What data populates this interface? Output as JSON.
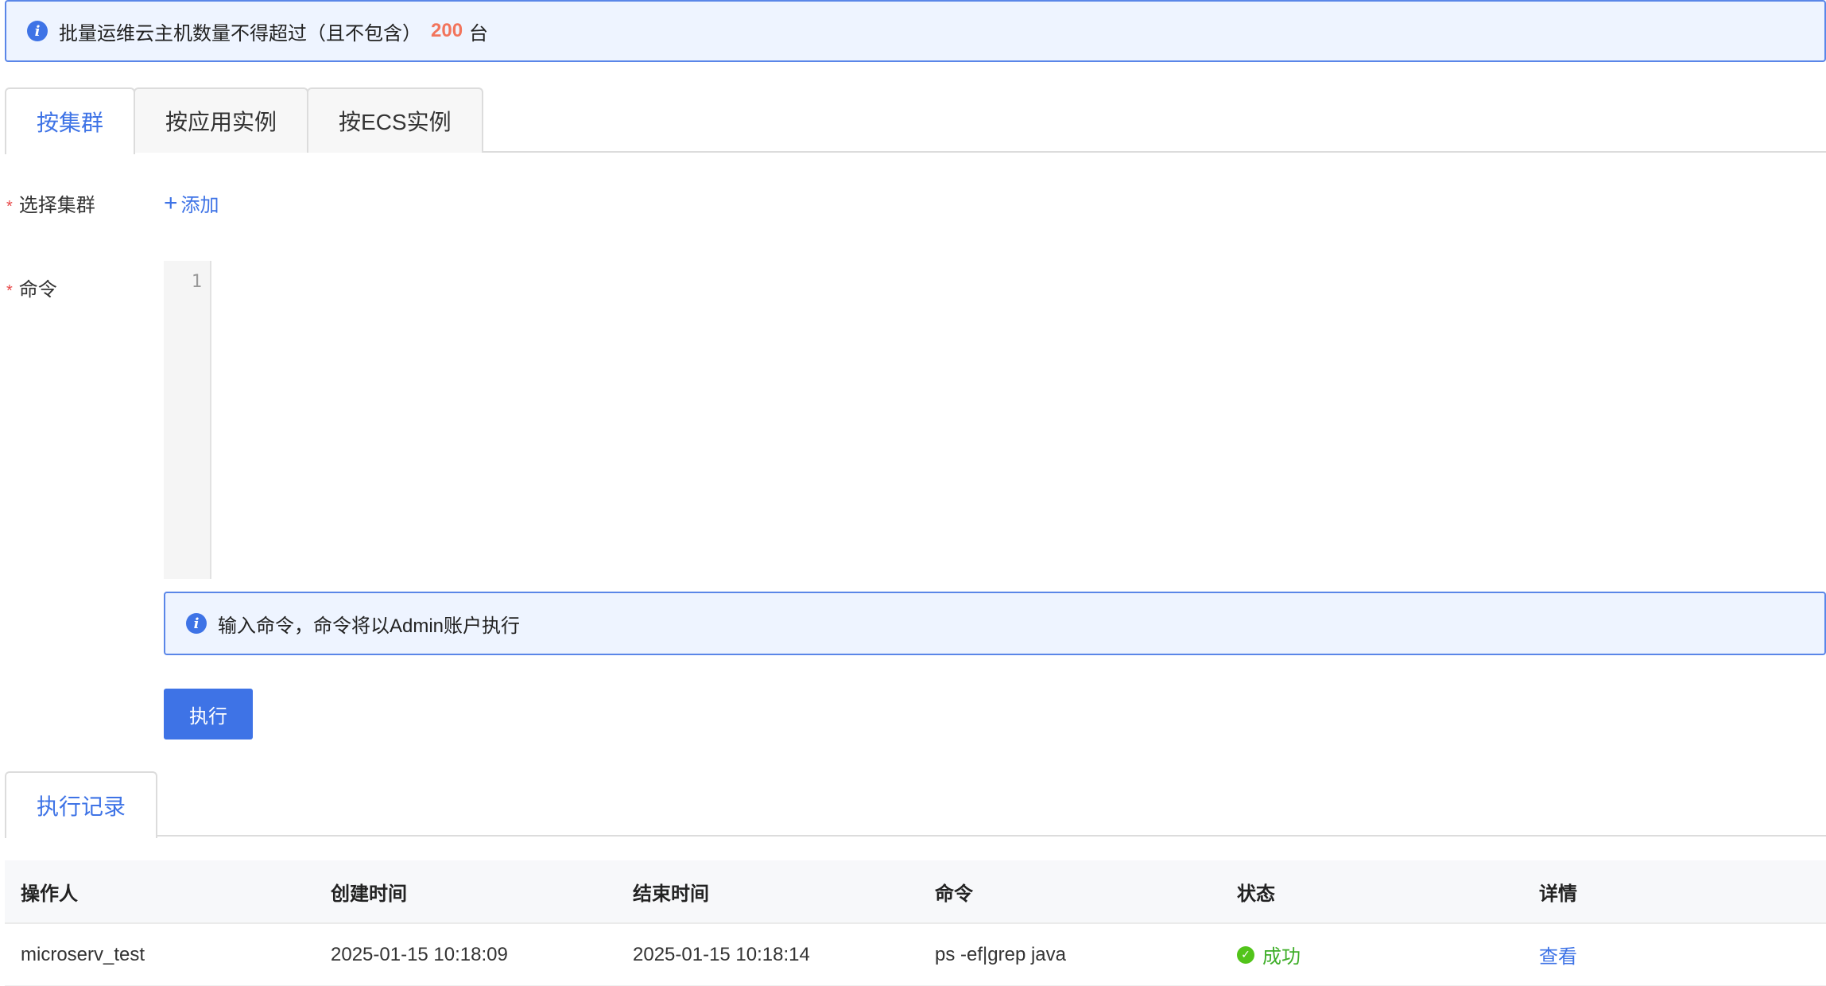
{
  "top_alert": {
    "text": "批量运维云主机数量不得超过（且不包含）",
    "limit": "200",
    "unit": "台"
  },
  "tabs": [
    {
      "label": "按集群",
      "active": true
    },
    {
      "label": "按应用实例",
      "active": false
    },
    {
      "label": "按ECS实例",
      "active": false
    }
  ],
  "form": {
    "cluster_label": "选择集群",
    "add_label": "添加",
    "command_label": "命令",
    "required_mark": "*",
    "line_number": "1",
    "hint": "输入命令，命令将以Admin账户执行",
    "execute_label": "执行"
  },
  "records": {
    "tab_label": "执行记录",
    "columns": [
      "操作人",
      "创建时间",
      "结束时间",
      "命令",
      "状态",
      "详情"
    ],
    "rows": [
      {
        "operator": "microserv_test",
        "created": "2025-01-15 10:18:09",
        "ended": "2025-01-15 10:18:14",
        "command": "ps -ef|grep java",
        "status": "成功",
        "detail": "查看"
      }
    ]
  },
  "colors": {
    "accent": "#3e73e6",
    "limit": "#f2745c",
    "success": "#52c41a",
    "required": "#e84848"
  }
}
